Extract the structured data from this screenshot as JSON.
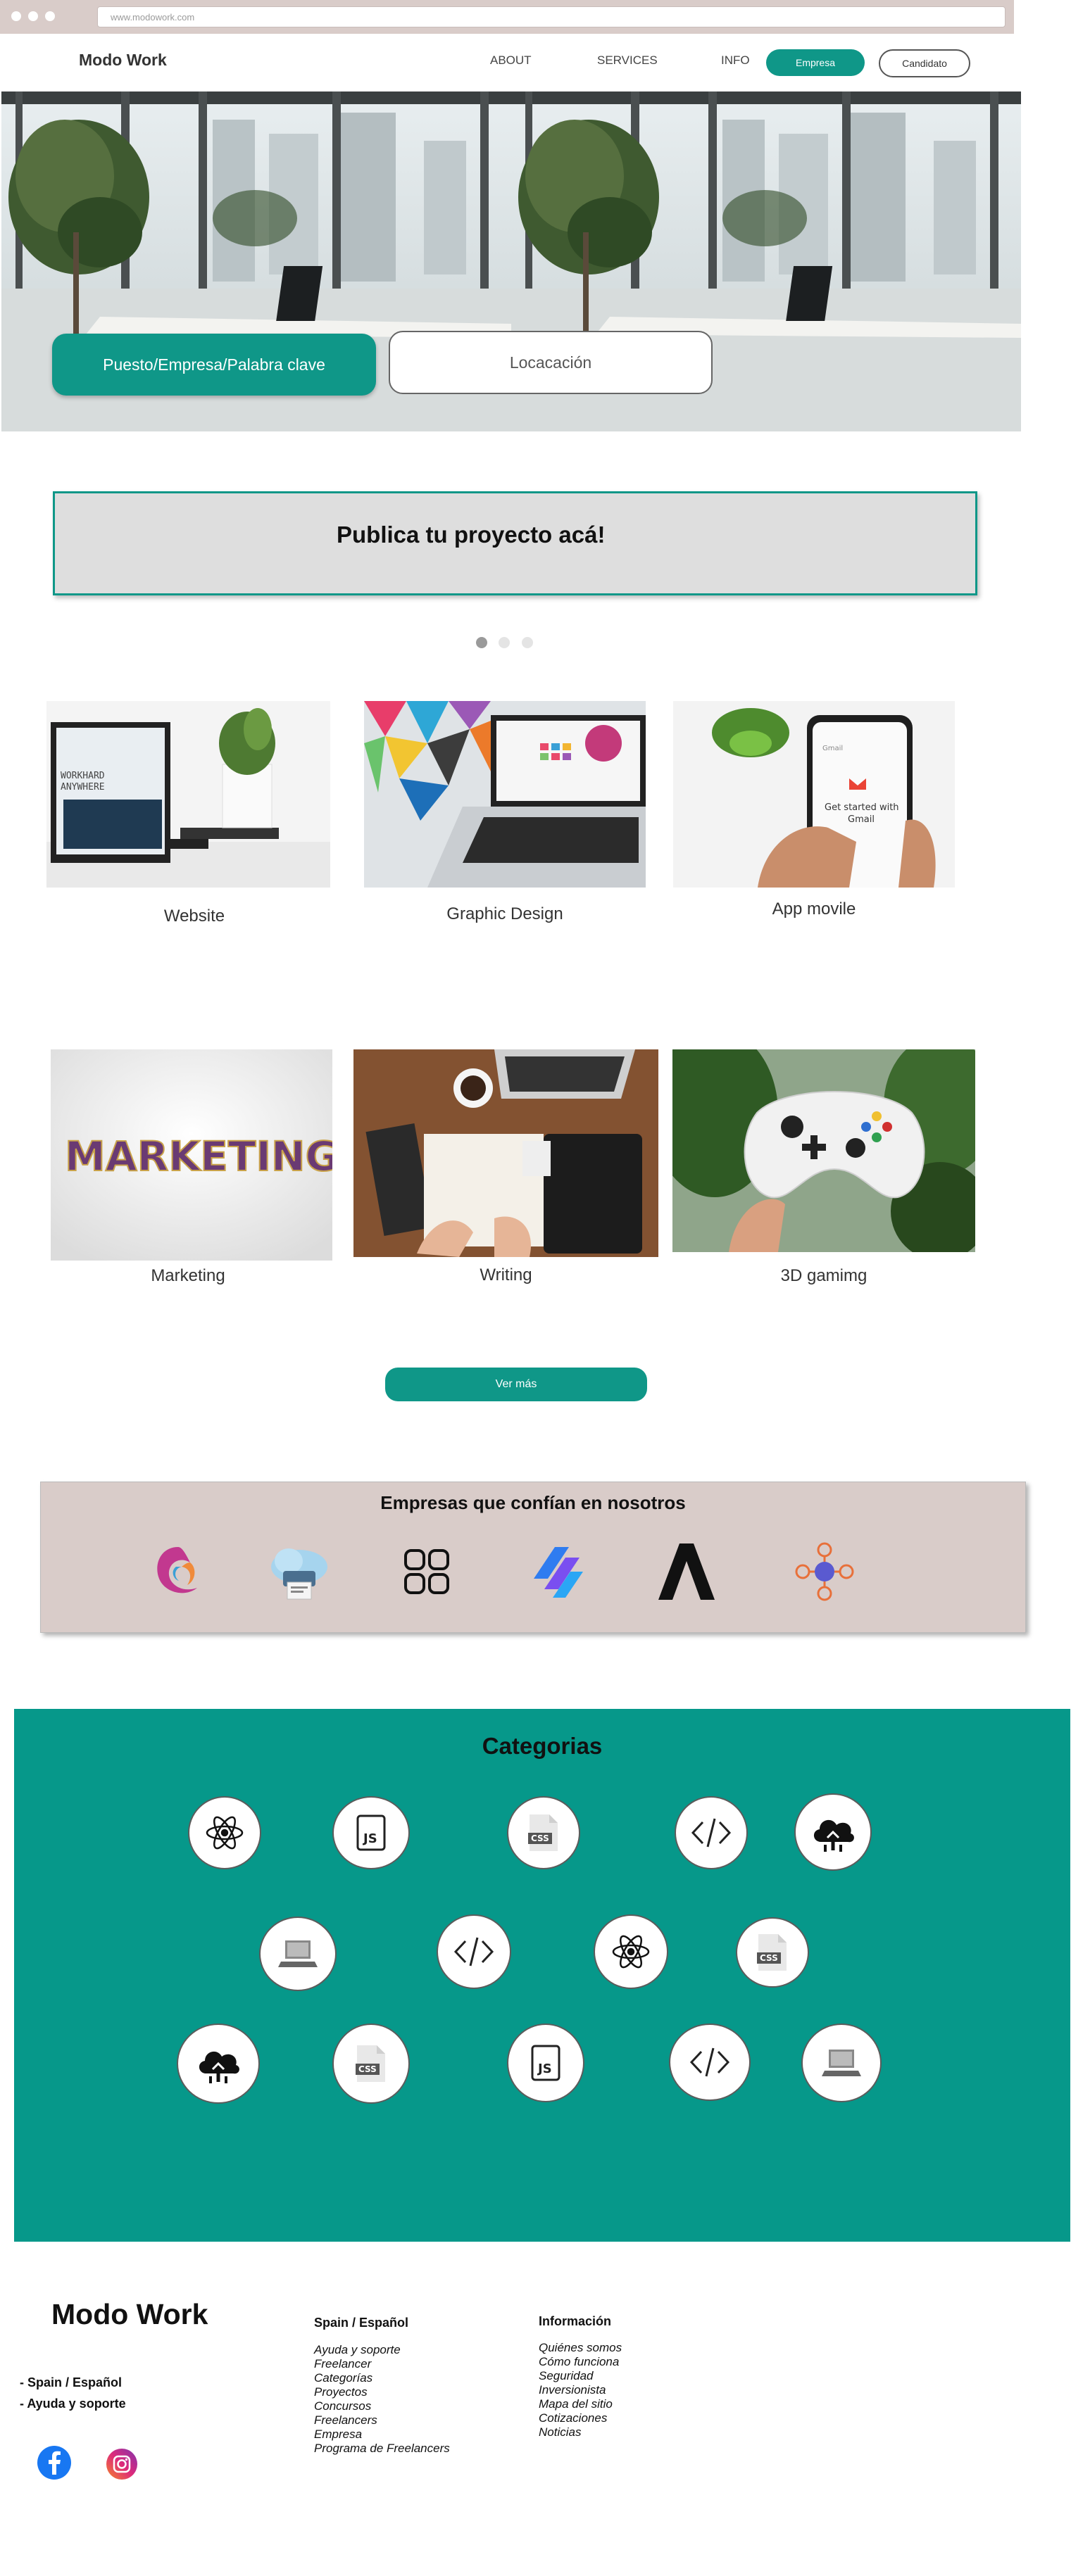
{
  "browser": {
    "url": "www.modowork.com"
  },
  "nav": {
    "brand": "Modo Work",
    "links": [
      "ABOUT",
      "SERVICES",
      "INFO"
    ],
    "empresa_button": "Empresa",
    "candidato_button": "Candidato"
  },
  "hero": {
    "keyword_placeholder": "Puesto/Empresa/Palabra clave",
    "location_placeholder": "Locacación"
  },
  "publica": {
    "title": "Publica tu proyecto acá!"
  },
  "carousel": {
    "dots": 3,
    "active": 0
  },
  "services": [
    {
      "label": "Website",
      "image": "laptop-workspace"
    },
    {
      "label": "Graphic Design",
      "image": "laptop-design"
    },
    {
      "label": "App movile",
      "image": "phone-gmail"
    },
    {
      "label": "Marketing",
      "image": "marketing-letters"
    },
    {
      "label": "Writing",
      "image": "desk-writing"
    },
    {
      "label": "3D gamimg",
      "image": "game-controller"
    }
  ],
  "ver_mas": "Ver más",
  "empresas": {
    "title": "Empresas que confían en nosotros",
    "logos": [
      "swirl-logo",
      "cloud-printer-logo",
      "four-squares-logo",
      "stripes-logo",
      "a-letter-logo",
      "network-logo"
    ]
  },
  "categorias": {
    "title": "Categorias",
    "icons": [
      "react-icon",
      "js-file-icon",
      "css-file-icon",
      "code-icon",
      "cloud-upload-icon",
      "laptop-icon",
      "code-icon",
      "react-icon",
      "css-file-icon",
      "cloud-upload-icon",
      "css-file-icon",
      "js-file-icon",
      "code-icon",
      "laptop-icon"
    ]
  },
  "footer": {
    "brand": "Modo Work",
    "left_links": [
      "- Spain / Español",
      "- Ayuda y soporte"
    ],
    "col1_title": "Spain / Español",
    "col1_items": [
      "Ayuda y soporte",
      "Freelancer",
      "Categorías",
      "Proyectos",
      "Concursos",
      "Freelancers",
      "Empresa",
      "Programa de Freelancers"
    ],
    "col2_title": "Información",
    "col2_items": [
      "Quiénes somos",
      "Cómo funciona",
      "Seguridad",
      "Inversionista",
      "Mapa del sitio",
      "Cotizaciones",
      "Noticias"
    ],
    "social": [
      "facebook-icon",
      "instagram-icon"
    ]
  },
  "colors": {
    "accent": "#0f9788",
    "chrome": "#d9ccc9",
    "panel": "#dedede"
  }
}
